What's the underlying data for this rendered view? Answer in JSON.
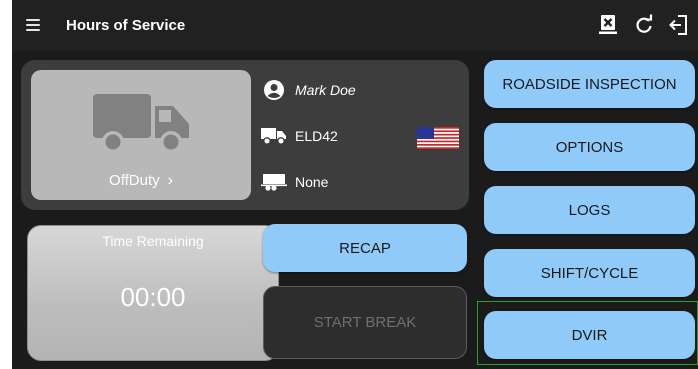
{
  "app_bar": {
    "title": "Hours of Service",
    "icons": [
      "menu-icon",
      "inspection-report-icon",
      "refresh-icon",
      "logout-icon"
    ]
  },
  "status_panel": {
    "duty_status": "OffDuty",
    "driver_name": "Mark Doe",
    "vehicle": "ELD42",
    "trailer": "None",
    "flag": "US"
  },
  "time_remaining": {
    "label": "Time Remaining",
    "value": "00:00"
  },
  "actions": {
    "recap": "RECAP",
    "start_break": "START BREAK"
  },
  "side_menu": {
    "roadside_inspection": "ROADSIDE INSPECTION",
    "options": "OPTIONS",
    "logs": "LOGS",
    "shift_cycle": "SHIFT/CYCLE",
    "dvir": "DVIR"
  },
  "colors": {
    "background": "#1b1b1b",
    "app_bar": "#212121",
    "accent_button": "#90caf9",
    "focus_outline": "#2aa12a"
  }
}
